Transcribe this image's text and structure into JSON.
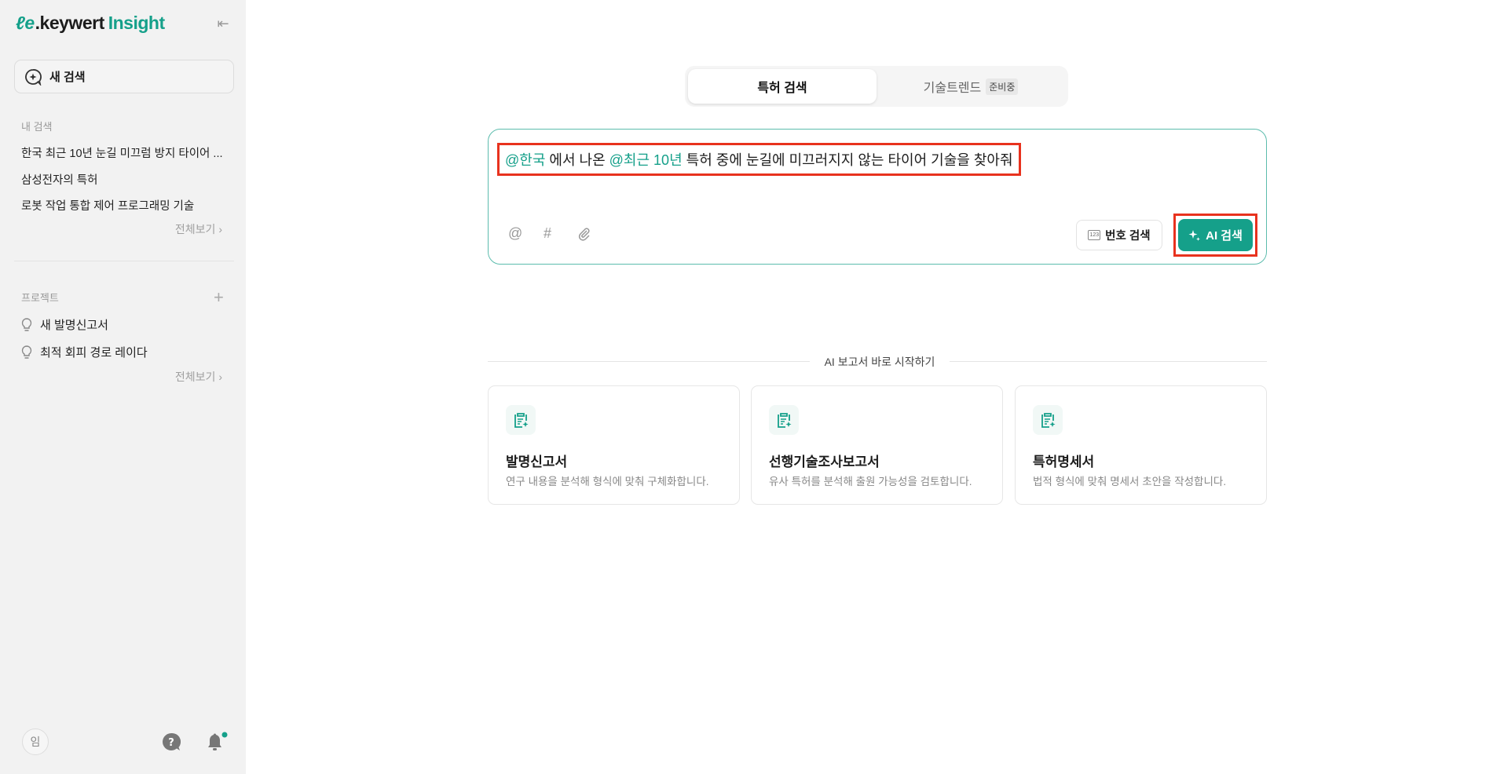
{
  "sidebar": {
    "logo": {
      "mark": "ℓe",
      "brand": ".keywert",
      "product": "Insight"
    },
    "new_search": "새 검색",
    "my_search_label": "내 검색",
    "recent": [
      "한국 최근 10년 눈길 미끄럼 방지 타이어 ...",
      "삼성전자의 특허",
      "로봇 작업 통합 제어 프로그래밍 기술"
    ],
    "view_all": "전체보기 ›",
    "projects_label": "프로젝트",
    "projects": [
      "새 발명신고서",
      "최적 회피 경로 레이다"
    ],
    "avatar": "임"
  },
  "tabs": [
    {
      "label": "특허 검색"
    },
    {
      "label": "기술트렌드",
      "badge": "준비중"
    }
  ],
  "search": {
    "mention1": "@한국",
    "text1": " 에서 나온 ",
    "mention2": "@최근 10년",
    "text2": " 특허 중에 눈길에 미끄러지지 않는 타이어 기술을 찾아줘",
    "tools": [
      "@",
      "#"
    ],
    "number_search": "번호 검색",
    "number_icon_text": "123",
    "ai_search": "AI 검색"
  },
  "reports": {
    "label": "AI 보고서 바로 시작하기",
    "cards": [
      {
        "title": "발명신고서",
        "desc": "연구 내용을 분석해 형식에 맞춰 구체화합니다."
      },
      {
        "title": "선행기술조사보고서",
        "desc": "유사 특허를 분석해 출원 가능성을 검토합니다."
      },
      {
        "title": "특허명세서",
        "desc": "법적 형식에 맞춰 명세서 초안을 작성합니다."
      }
    ]
  },
  "colors": {
    "accent": "#15a08a",
    "highlight": "#e8321e",
    "sidebar_bg": "#f2f2f2"
  }
}
